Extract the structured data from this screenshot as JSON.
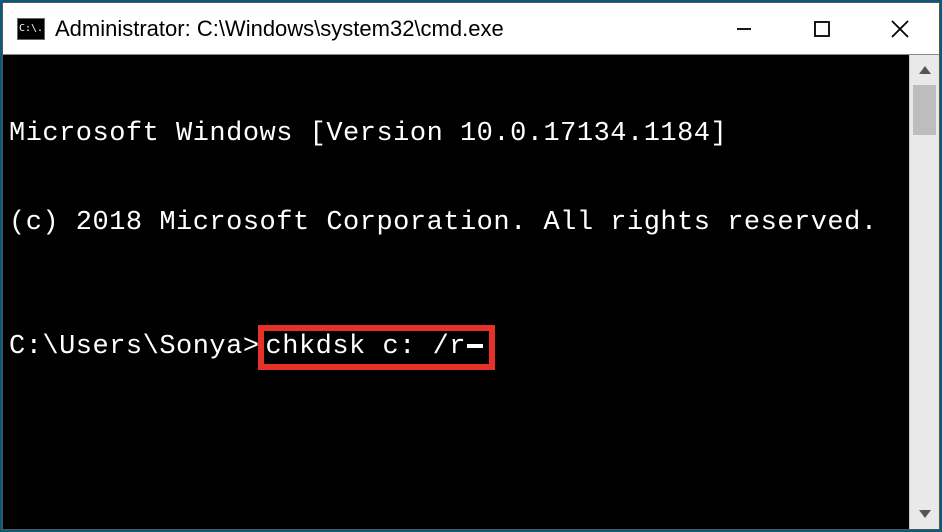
{
  "titlebar": {
    "icon_label": "C:\\.",
    "title": "Administrator: C:\\Windows\\system32\\cmd.exe"
  },
  "terminal": {
    "line1": "Microsoft Windows [Version 10.0.17134.1184]",
    "line2": "(c) 2018 Microsoft Corporation. All rights reserved.",
    "prompt": "C:\\Users\\Sonya>",
    "command": "chkdsk c: /r"
  },
  "colors": {
    "highlight_border": "#e63226",
    "terminal_bg": "#000000",
    "terminal_fg": "#ffffff"
  }
}
